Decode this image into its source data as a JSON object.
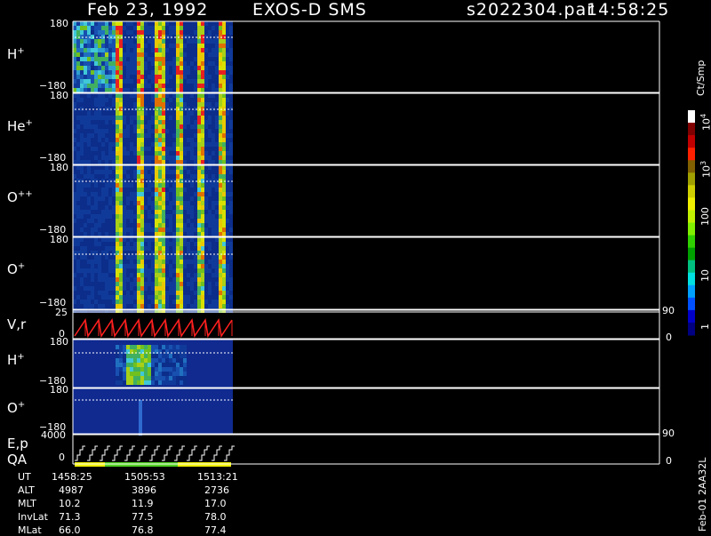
{
  "header": {
    "date": "Feb 23, 1992",
    "instrument": "EXOS-D SMS",
    "file": "s2022304.par",
    "time": "14:58:25"
  },
  "colorbar": {
    "label": "Ct/Smp",
    "ticks": [
      "1",
      "10",
      "100",
      "10",
      "10"
    ],
    "tick_superscripts": [
      "",
      "",
      "",
      "3",
      "4"
    ],
    "colors": [
      "#000080",
      "#0000c8",
      "#0050ff",
      "#00a0ff",
      "#00e0e0",
      "#00c080",
      "#00a000",
      "#30d000",
      "#80f000",
      "#c0f000",
      "#f0f000",
      "#d0d000",
      "#a0a000",
      "#806000",
      "#ff2000",
      "#c00000",
      "#800000",
      "#ffffff"
    ]
  },
  "panels": [
    {
      "id": "H+",
      "label": "H",
      "sup": "+",
      "ymax": "180",
      "ymin": "−180"
    },
    {
      "id": "He+",
      "label": "He",
      "sup": "+",
      "ymax": "180",
      "ymin": "−180"
    },
    {
      "id": "O++",
      "label": "O",
      "sup": "++",
      "ymax": "180",
      "ymin": "−180"
    },
    {
      "id": "O+",
      "label": "O",
      "sup": "+",
      "ymax": "180",
      "ymin": "−180"
    },
    {
      "id": "Vr",
      "label": "V,r",
      "sup": "",
      "ymax": "25",
      "ymin": "0",
      "rmax": "90",
      "rmin": "0"
    },
    {
      "id": "H+2",
      "label": "H",
      "sup": "+",
      "ymax": "180",
      "ymin": "−180"
    },
    {
      "id": "O+2",
      "label": "O",
      "sup": "+",
      "ymax": "180",
      "ymin": "−180"
    },
    {
      "id": "Ep",
      "label": "E,p",
      "label2": "QA",
      "sup": "",
      "ymax": "4000",
      "ymin": "0",
      "rmax": "90",
      "rmin": "0"
    }
  ],
  "version_label": "Feb-01 2AA32L",
  "ephemeris": {
    "rows": [
      {
        "name": "UT",
        "values": [
          "1458:25",
          "1505:53",
          "1513:21"
        ]
      },
      {
        "name": "ALT",
        "values": [
          "4987",
          "3896",
          "2736"
        ]
      },
      {
        "name": "MLT",
        "values": [
          "10.2",
          "11.9",
          "17.0"
        ]
      },
      {
        "name": "InvLat",
        "values": [
          "71.3",
          "77.5",
          "78.0"
        ]
      },
      {
        "name": "MLat",
        "values": [
          "66.0",
          "76.8",
          "77.4"
        ]
      }
    ]
  },
  "chart_data": {
    "type": "heatmap",
    "x_range": [
      "1458:25",
      "1513:21"
    ],
    "y_range": [
      -180,
      180
    ],
    "notes": "spectrogram panels of ion counts vs pitch angle"
  }
}
